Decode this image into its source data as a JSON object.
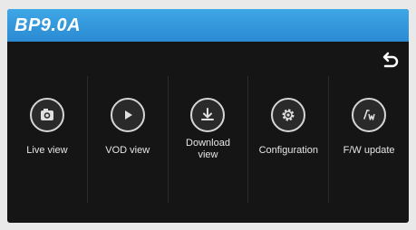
{
  "header": {
    "title": "BP9.0A"
  },
  "icons": {
    "back": "back-arrow-icon"
  },
  "menu": {
    "items": [
      {
        "label": "Live view",
        "icon": "camera-icon"
      },
      {
        "label": "VOD view",
        "icon": "play-icon"
      },
      {
        "label": "Download view",
        "icon": "download-icon"
      },
      {
        "label": "Configuration",
        "icon": "gear-icon"
      },
      {
        "label": "F/W update",
        "icon": "firmware-update-icon"
      }
    ]
  },
  "colors": {
    "titlebar": "#2a8ad2",
    "background": "#151515",
    "icon_border": "#d6d6d6"
  }
}
